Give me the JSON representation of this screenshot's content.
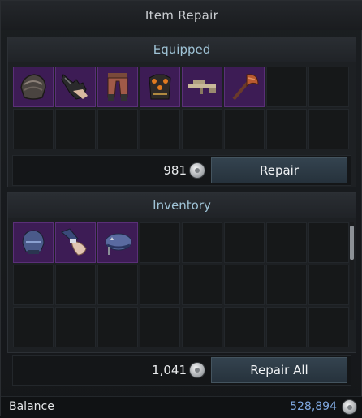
{
  "window": {
    "title": "Item Repair"
  },
  "equipped": {
    "header": "Equipped",
    "items": [
      {
        "icon": "shoulder-armor-icon"
      },
      {
        "icon": "glove-icon"
      },
      {
        "icon": "leg-armor-icon"
      },
      {
        "icon": "chest-armor-icon"
      },
      {
        "icon": "rifle-weapon-icon"
      },
      {
        "icon": "axe-weapon-icon"
      }
    ],
    "cost": "981",
    "repair_label": "Repair"
  },
  "inventory": {
    "header": "Inventory",
    "items": [
      {
        "icon": "helmet-icon"
      },
      {
        "icon": "glove-icon"
      },
      {
        "icon": "beret-cap-icon"
      }
    ],
    "cost": "1,041",
    "repair_all_label": "Repair All"
  },
  "balance": {
    "label": "Balance",
    "value": "528,894"
  },
  "colors": {
    "slot_filled": "#3d1c55",
    "accent_text": "#9fc3d6",
    "balance_value": "#7fa8e0"
  }
}
